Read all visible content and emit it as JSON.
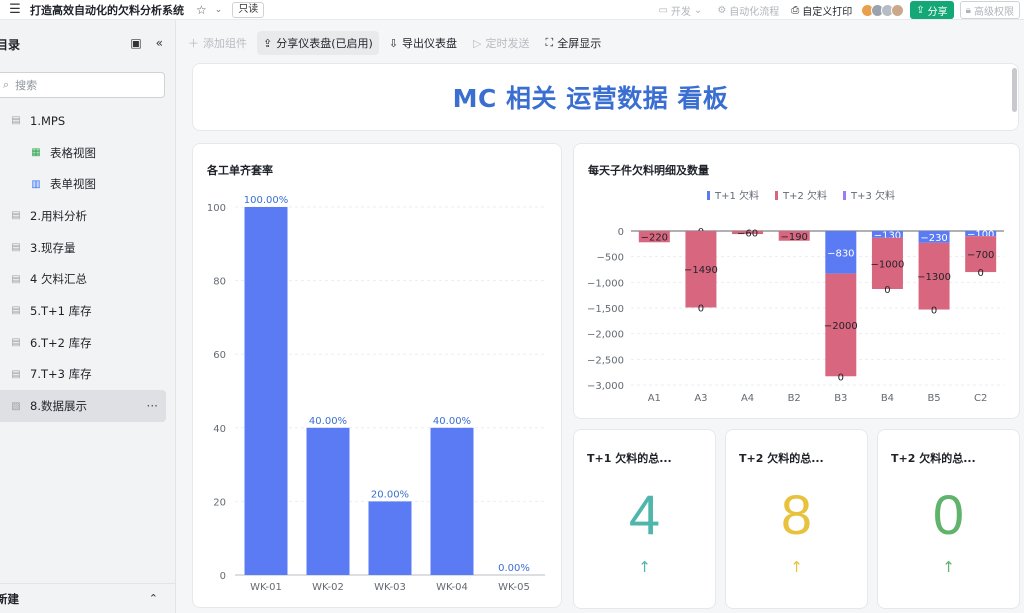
{
  "topbar": {
    "menu_icon": "hamburger-icon",
    "title": "打造高效自动化的欠料分析系统",
    "readonly": "只读",
    "develop": "开发",
    "automation": "自动化流程",
    "custom_print": "自定义打印",
    "share": "分享",
    "advanced_perm": "高级权限"
  },
  "sidebar": {
    "header": "目录",
    "search_placeholder": "搜索",
    "items": [
      {
        "label": "1.MPS",
        "type": "doc"
      },
      {
        "label": "表格视图",
        "type": "grid-sub"
      },
      {
        "label": "表单视图",
        "type": "form-sub"
      },
      {
        "label": "2.用料分析",
        "type": "doc"
      },
      {
        "label": "3.现存量",
        "type": "doc"
      },
      {
        "label": "4 欠料汇总",
        "type": "doc"
      },
      {
        "label": "5.T+1 库存",
        "type": "doc"
      },
      {
        "label": "6.T+2 库存",
        "type": "doc"
      },
      {
        "label": "7.T+3 库存",
        "type": "doc"
      },
      {
        "label": "8.数据展示",
        "type": "dashboard",
        "active": true
      }
    ],
    "more": "···",
    "footer": "新建"
  },
  "toolbar": {
    "add_component": "添加组件",
    "share_dashboard": "分享仪表盘(已启用)",
    "export_dashboard": "导出仪表盘",
    "scheduled_send": "定时发送",
    "fullscreen": "全屏显示"
  },
  "dashboard": {
    "title": "MC 相关 运营数据 看板",
    "colors": {
      "accent": "#3a6fd1",
      "bar_blue": "#5b7bf5",
      "bar_pink": "#d9667f",
      "bar_purple": "#9b7cf5"
    }
  },
  "chart_data": [
    {
      "type": "bar",
      "title": "各工单齐套率",
      "categories": [
        "WK-01",
        "WK-02",
        "WK-03",
        "WK-04",
        "WK-05"
      ],
      "values": [
        100,
        40,
        20,
        40,
        0
      ],
      "value_labels": [
        "100.00%",
        "40.00%",
        "20.00%",
        "40.00%",
        "0.00%"
      ],
      "ylim": [
        0,
        100
      ],
      "yticks": [
        0,
        20,
        40,
        60,
        80,
        100
      ],
      "grid": true
    },
    {
      "type": "bar",
      "stacked": true,
      "title": "每天子件欠料明细及数量",
      "legend_position": "top",
      "categories": [
        "A1",
        "A3",
        "A4",
        "B2",
        "B3",
        "B4",
        "B5",
        "C2"
      ],
      "ylim": [
        -3000,
        0
      ],
      "yticks": [
        0,
        -500,
        -1000,
        -1500,
        -2000,
        -2500,
        -3000
      ],
      "ytick_labels": [
        "0",
        "−500",
        "−1,000",
        "−1,500",
        "−2,000",
        "−2,500",
        "−3,000"
      ],
      "series": [
        {
          "name": "T+1 欠料",
          "values": [
            0,
            0,
            0,
            0,
            -830,
            -130,
            -230,
            -100
          ],
          "labels": [
            "",
            "0",
            "",
            "",
            "−830",
            "−130",
            "−230",
            "−100"
          ]
        },
        {
          "name": "T+2 欠料",
          "values": [
            -220,
            -1490,
            -60,
            -190,
            -2000,
            -1000,
            -1300,
            -700
          ],
          "labels": [
            "−220",
            "−1490",
            "−60",
            "−190",
            "−2000",
            "−1000",
            "−1300",
            "−700"
          ]
        },
        {
          "name": "T+3 欠料",
          "values": [
            0,
            0,
            0,
            0,
            0,
            0,
            0,
            0
          ],
          "labels": [
            "",
            "0",
            "",
            "",
            "0",
            "0",
            "0",
            "0"
          ]
        }
      ]
    }
  ],
  "kpis": [
    {
      "title": "T+1 欠料的总...",
      "value": "4",
      "color": "#4fb6ab",
      "arrow": "↑"
    },
    {
      "title": "T+2 欠料的总...",
      "value": "8",
      "color": "#e8c13d",
      "arrow": "↑"
    },
    {
      "title": "T+2 欠料的总...",
      "value": "0",
      "color": "#5fb36b",
      "arrow": "↑"
    }
  ]
}
